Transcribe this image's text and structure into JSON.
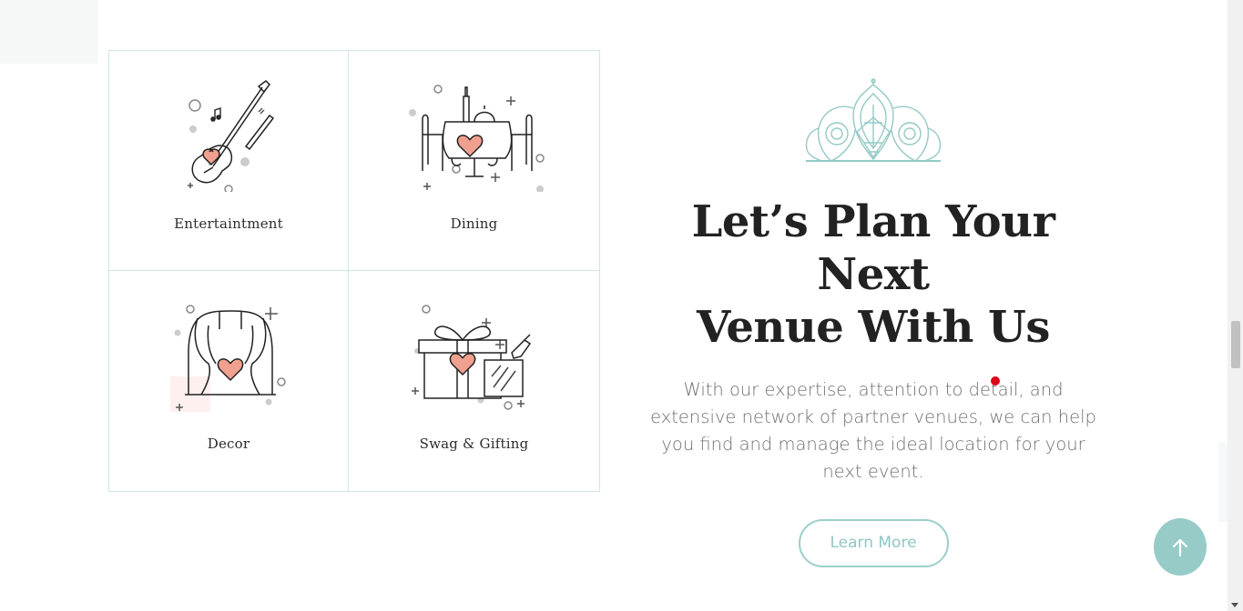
{
  "services": [
    {
      "label": "Entertaintment",
      "icon": "guitar-icon"
    },
    {
      "label": "Dining",
      "icon": "dining-table-icon"
    },
    {
      "label": "Decor",
      "icon": "curtain-stage-icon"
    },
    {
      "label": "Swag & Gifting",
      "icon": "gift-box-icon"
    }
  ],
  "promo": {
    "headline_line1": "Let’s Plan Your Next",
    "headline_line2": "Venue With Us",
    "description": "With our expertise, attention to detail, and extensive network of partner venues, we can help you find and manage the ideal location for your next event.",
    "cta_label": "Learn More",
    "ornament_icon": "mandala-icon"
  },
  "back_to_top_icon": "arrow-up-icon",
  "colors": {
    "accent": "#97cbc8",
    "heart": "#f0a08e",
    "grid_border": "#cfe7e5",
    "heading": "#222222",
    "body_text": "#6f6f6f"
  }
}
